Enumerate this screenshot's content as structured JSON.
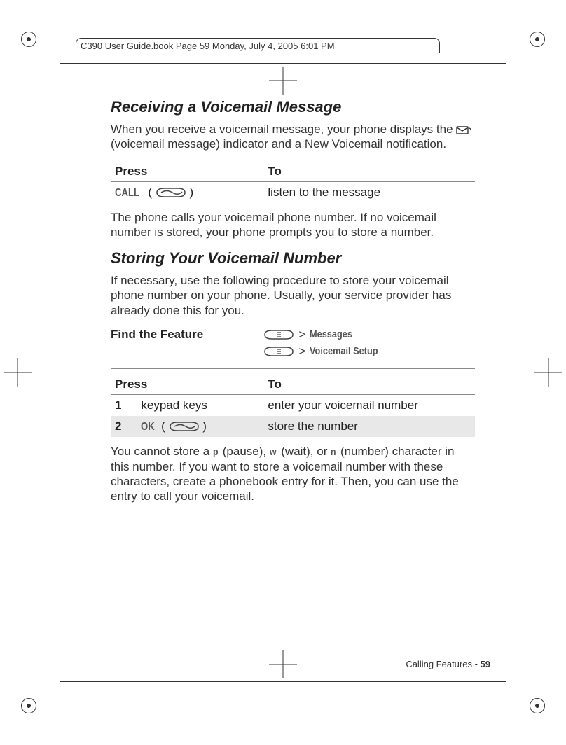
{
  "running_header": "C390 User Guide.book  Page 59  Monday, July 4, 2005  6:01 PM",
  "section1": {
    "title": "Receiving a Voicemail Message",
    "intro_before_icon": "When you receive a voicemail message, your phone displays the ",
    "intro_after_icon": " (voicemail message) indicator and a New Voicemail notification.",
    "table": {
      "h1": "Press",
      "h2": "To",
      "soft_label": "CALL",
      "action": "listen to the message"
    },
    "after": "The phone calls your voicemail phone number. If no voicemail number is stored, your phone prompts you to store a number."
  },
  "section2": {
    "title": "Storing Your Voicemail Number",
    "intro": "If necessary, use the following procedure to store your voicemail phone number on your phone. Usually, your service provider has already done this for you.",
    "feature_label": "Find the Feature",
    "menu1": "Messages",
    "menu2": "Voicemail Setup",
    "gt": ">",
    "table": {
      "h1": "Press",
      "h2": "To",
      "r1_num": "1",
      "r1_press": "keypad keys",
      "r1_to": "enter your voicemail number",
      "r2_num": "2",
      "r2_soft": "OK",
      "r2_to": "store the number"
    },
    "after_1": "You cannot store a ",
    "p_char": "p",
    "after_2": " (pause), ",
    "w_char": "w",
    "after_3": " (wait), or ",
    "n_char": "n",
    "after_4": " (number) character in this number. If you want to store a voicemail number with these characters, create a phonebook entry for it. Then, you can use the entry to call your voicemail."
  },
  "footer": {
    "section": "Calling Features - ",
    "page": "59"
  }
}
